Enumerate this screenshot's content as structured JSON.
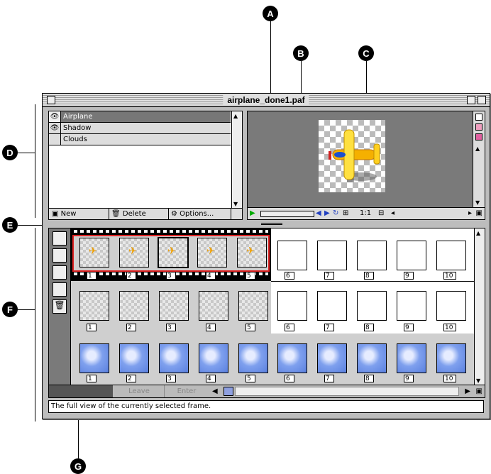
{
  "callouts": {
    "a": "A",
    "b": "B",
    "c": "C",
    "d": "D",
    "e": "E",
    "f": "F",
    "g": "G"
  },
  "window": {
    "title": "airplane_done1.paf"
  },
  "layers": {
    "items": [
      {
        "name": "Airplane",
        "visible": true,
        "selected": true
      },
      {
        "name": "Shadow",
        "visible": true,
        "selected": false
      },
      {
        "name": "Clouds",
        "visible": false,
        "selected": false
      }
    ],
    "buttons": {
      "new": "New",
      "delete": "Delete",
      "options": "Options..."
    }
  },
  "preview": {
    "zoom": "1:1"
  },
  "timeline": {
    "airplane_frames": [
      "1",
      "2",
      "3",
      "4",
      "5"
    ],
    "empty_frames": [
      "6",
      "7",
      "8",
      "9",
      "10"
    ],
    "shadow_frames": [
      "1",
      "2",
      "3",
      "4",
      "5"
    ],
    "cloud_frames": [
      "1",
      "2",
      "3",
      "4",
      "5",
      "6",
      "7",
      "8",
      "9",
      "10"
    ],
    "leave": "Leave",
    "enter": "Enter"
  },
  "status": {
    "text": "The full view of the currently selected frame."
  },
  "colors": {
    "selection": "#dd2222",
    "window": "#bdbdbd",
    "preview_bg": "#7a7a7a"
  }
}
